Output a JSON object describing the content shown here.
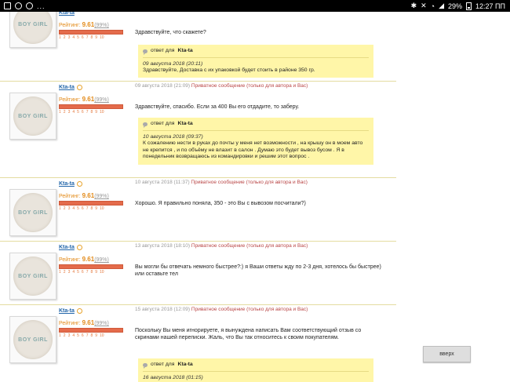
{
  "status_bar": {
    "dots": "...",
    "battery_percent": "29%",
    "time": "12:27 ПП"
  },
  "user": {
    "name": "Kta-ta",
    "rating_label": "Рейтинг:",
    "rating_value": "9.61",
    "rating_percent": "(99%)",
    "scale": [
      "1",
      "2",
      "3",
      "4",
      "5",
      "6",
      "7",
      "8",
      "9",
      "10"
    ]
  },
  "posts": [
    {
      "meta_date": "",
      "meta_private": "",
      "message": "Здравствуйте, что скажете?",
      "reply": {
        "for_label": "ответ для",
        "for_name": "Kta-ta",
        "date": "09 августа 2018 (20:11)",
        "text": "Здравствуйте, Доставка с их упаковкой будет стоить в районе 350 гр."
      }
    },
    {
      "meta_date": "09 августа 2018 (21:09)",
      "meta_private": "Приватное сообщение (только для автора и Вас)",
      "message": "Здравствуйте, спасибо. Если за 400 Вы его отдадите, то заберу.",
      "reply": {
        "for_label": "ответ для",
        "for_name": "Kta-ta",
        "date": "10 августа 2018 (09:37)",
        "text": "К сожалению нести в руках до почты у меня нет возможности , на крышу он в моем авто не крепится , и по объёму не влазит в салон . Думаю это будет вывоз бусом . Я в понедельник возвращаюсь из командировки и решим этот вопрос ."
      }
    },
    {
      "meta_date": "10 августа 2018 (11:37)",
      "meta_private": "Приватное сообщение (только для автора и Вас)",
      "message": "Хорошо. Я правильно поняла, 350 - это Вы с вывозом посчитали?)"
    },
    {
      "meta_date": "13 августа 2018 (18:10)",
      "meta_private": "Приватное сообщение (только для автора и Вас)",
      "message": "Вы могли бы отвечать немного быстрее?:) я Ваши ответы жду по 2-3 дня, хотелось бы быстрее) или оставьте тел"
    },
    {
      "meta_date": "15 августа 2018 (12:09)",
      "meta_private": "Приватное сообщение (только для автора и Вас)",
      "message": "Поскольку Вы меня игнорируете, я вынуждена написать Вам соответствующий отзыв со скринами нашей переписки. Жаль, что Вы так относитесь к своим покупателям.",
      "reply": {
        "for_label": "ответ для",
        "for_name": "Kta-ta",
        "date": "16 августа 2018 (01:15)",
        "text": ""
      }
    }
  ],
  "scroll_up_label": "вверх"
}
